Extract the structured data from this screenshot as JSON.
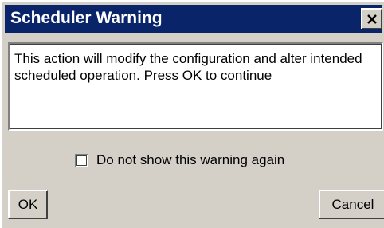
{
  "window": {
    "title": "Scheduler Warning",
    "close_icon": "close-icon"
  },
  "message": {
    "text": "This action will modify the configuration and alter intended scheduled operation. Press OK to continue"
  },
  "checkbox": {
    "label": "Do not show this warning again",
    "checked": false
  },
  "buttons": {
    "ok_label": "OK",
    "cancel_label": "Cancel"
  },
  "colors": {
    "titlebar": "#0a246a",
    "title_text": "#ffffff",
    "dialog_face": "#d4d0c8"
  }
}
